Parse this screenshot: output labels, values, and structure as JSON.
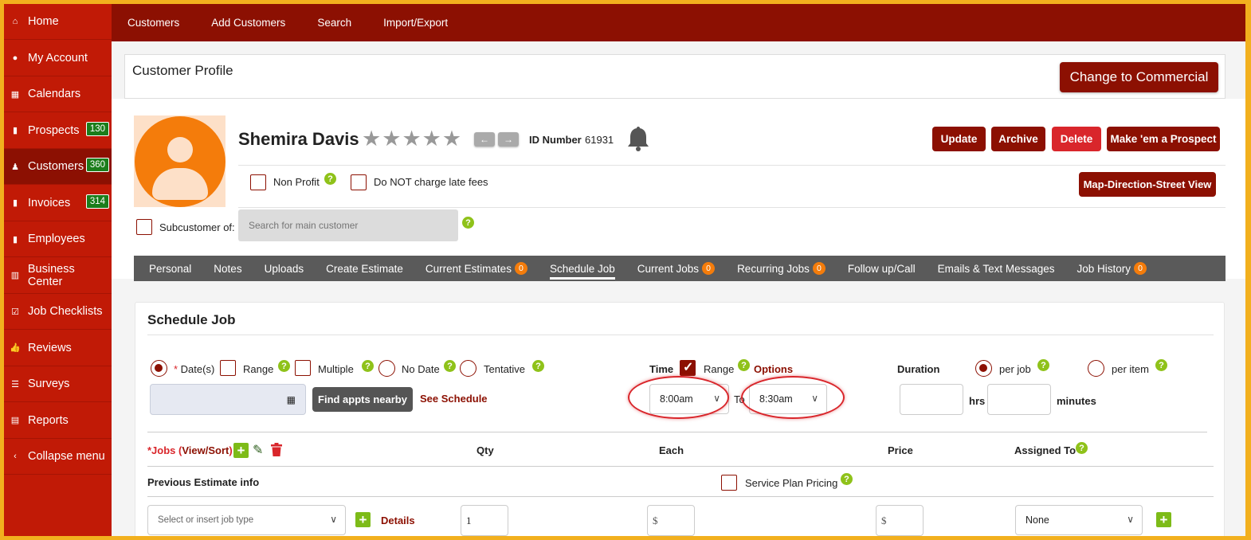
{
  "sidebar": {
    "items": [
      {
        "label": "Home",
        "icon": "home-icon",
        "glyph": "⌂"
      },
      {
        "label": "My Account",
        "icon": "user-circle-icon",
        "glyph": "●"
      },
      {
        "label": "Calendars",
        "icon": "calendar-icon",
        "glyph": "▦"
      },
      {
        "label": "Prospects",
        "icon": "file-icon",
        "glyph": "▮",
        "badge": "130"
      },
      {
        "label": "Customers",
        "icon": "users-icon",
        "glyph": "♟",
        "badge": "360"
      },
      {
        "label": "Invoices",
        "icon": "file-icon",
        "glyph": "▮",
        "badge": "314"
      },
      {
        "label": "Employees",
        "icon": "file-icon",
        "glyph": "▮"
      },
      {
        "label": "Business Center",
        "icon": "building-icon",
        "glyph": "▥"
      },
      {
        "label": "Job Checklists",
        "icon": "checkbox-icon",
        "glyph": "☑"
      },
      {
        "label": "Reviews",
        "icon": "thumbs-up-icon",
        "glyph": "👍"
      },
      {
        "label": "Surveys",
        "icon": "list-icon",
        "glyph": "☰"
      },
      {
        "label": "Reports",
        "icon": "clipboard-icon",
        "glyph": "▤"
      },
      {
        "label": "Collapse menu",
        "icon": "chevron-left-circle-icon",
        "glyph": "‹"
      }
    ]
  },
  "topnav": {
    "items": [
      "Customers",
      "Add Customers",
      "Search",
      "Import/Export"
    ]
  },
  "profile": {
    "title": "Customer Profile",
    "change_label": "Change to Commercial",
    "name": "Shemira Davis",
    "id_label": "ID Number",
    "id_value": "61931",
    "buttons": {
      "update": "Update",
      "archive": "Archive",
      "delete": "Delete",
      "prospect": "Make 'em a Prospect",
      "map": "Map-Direction-Street View"
    },
    "non_profit": "Non Profit",
    "late_fees": "Do NOT charge late fees",
    "subcustomer": "Subcustomer of:",
    "sub_placeholder": "Search for main customer"
  },
  "tabs": [
    {
      "label": "Personal"
    },
    {
      "label": "Notes"
    },
    {
      "label": "Uploads"
    },
    {
      "label": "Create Estimate"
    },
    {
      "label": "Current Estimates",
      "badge": "0"
    },
    {
      "label": "Schedule Job",
      "active": true
    },
    {
      "label": "Current Jobs",
      "badge": "0"
    },
    {
      "label": "Recurring Jobs",
      "badge": "0"
    },
    {
      "label": "Follow up/Call"
    },
    {
      "label": "Emails & Text Messages"
    },
    {
      "label": "Job History",
      "badge": "0"
    }
  ],
  "schedule": {
    "title": "Schedule Job",
    "dates_label": "Date(s)",
    "range_label": "Range",
    "multiple_label": "Multiple",
    "no_date_label": "No Date",
    "tentative_label": "Tentative",
    "find_label": "Find appts nearby",
    "see_schedule": "See Schedule",
    "time_label": "Time",
    "time_range_label": "Range",
    "options_label": "Options",
    "time_from": "8:00am",
    "to_label": "To",
    "time_to": "8:30am",
    "duration_label": "Duration",
    "per_job": "per job",
    "per_item": "per item",
    "hrs": "hrs",
    "minutes": "minutes",
    "jobs_prefix": "*Jobs (",
    "view_sort": "View/Sort",
    "jobs_suffix": ")",
    "qty_hdr": "Qty",
    "each_hdr": "Each",
    "price_hdr": "Price",
    "assigned_hdr": "Assigned To",
    "prev_estimate": "Previous Estimate info",
    "service_plan": "Service Plan Pricing",
    "job_type_placeholder": "Select or insert job type",
    "details": "Details",
    "qty_value": "1",
    "currency": "$",
    "assigned_value": "None"
  },
  "colors": {
    "brand_dark": "#8c1002",
    "sidebar": "#c11a06",
    "badge_green": "#1b7d1b",
    "help_green": "#8fc21a",
    "tab_badge": "#f47c0b",
    "delete": "#d9262b"
  }
}
